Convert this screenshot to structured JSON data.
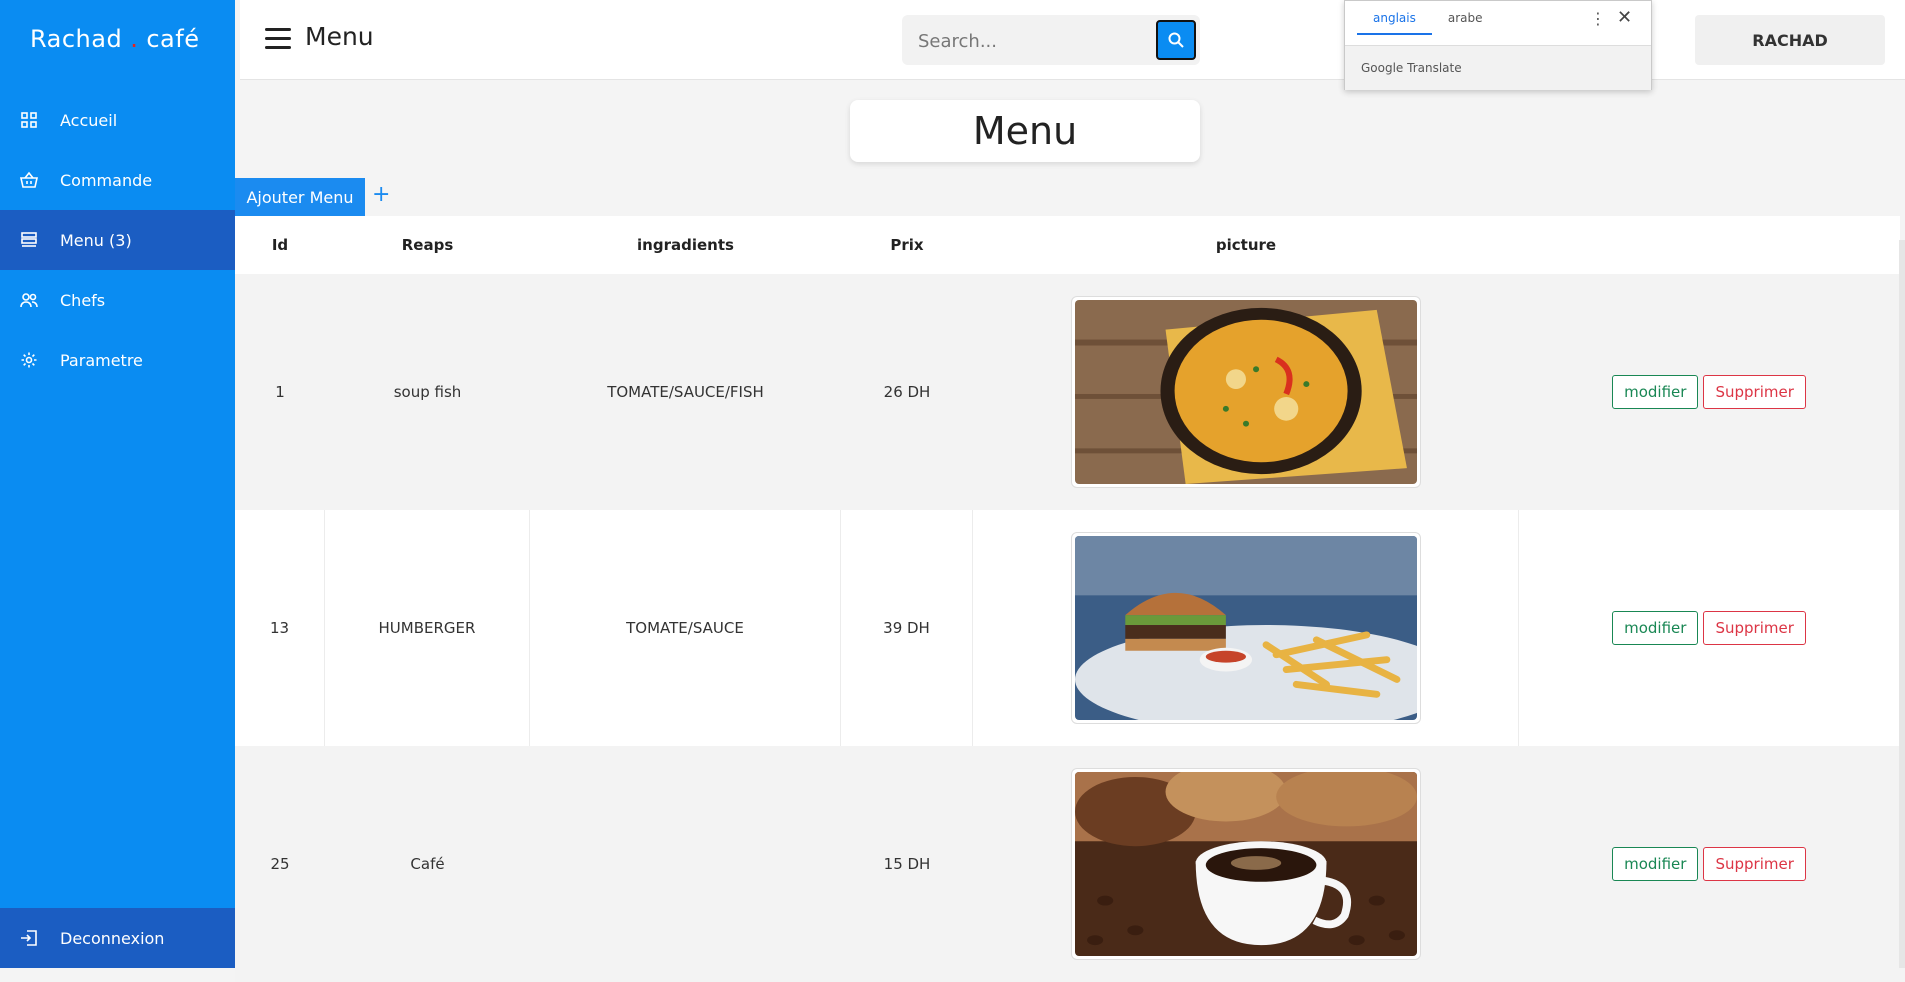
{
  "brand": {
    "name_left": "Rachad",
    "separator": ".",
    "name_right": "café"
  },
  "sidebar": {
    "items": [
      {
        "label": "Accueil",
        "icon": "grid-icon"
      },
      {
        "label": "Commande",
        "icon": "basket-icon"
      },
      {
        "label": "Menu (3)",
        "icon": "menu-list-icon",
        "active": true
      },
      {
        "label": "Chefs",
        "icon": "users-icon"
      },
      {
        "label": "Parametre",
        "icon": "gear-icon"
      }
    ],
    "logout_label": "Deconnexion"
  },
  "header": {
    "title": "Menu",
    "search_placeholder": "Search...",
    "user_label": "RACHAD"
  },
  "translate_popup": {
    "tabs": [
      "anglais",
      "arabe"
    ],
    "active_tab": "anglais",
    "footer": "Google Translate"
  },
  "main": {
    "heading": "Menu",
    "add_tab_label": "Ajouter Menu",
    "add_plus": "+",
    "table": {
      "columns": [
        "Id",
        "Reaps",
        "ingradients",
        "Prix",
        "picture"
      ],
      "rows": [
        {
          "id": "1",
          "name": "soup fish",
          "ingredients": "TOMATE/SAUCE/FISH",
          "price": "26 DH",
          "picture": "fish soup bowl"
        },
        {
          "id": "13",
          "name": "HUMBERGER",
          "ingredients": "TOMATE/SAUCE",
          "price": "39 DH",
          "picture": "hamburger with fries"
        },
        {
          "id": "25",
          "name": "Café",
          "ingredients": "",
          "price": "15 DH",
          "picture": "cup of coffee with cookies"
        }
      ],
      "edit_label": "modifier",
      "delete_label": "Supprimer"
    }
  },
  "colors": {
    "sidebar": "#0a8cf2",
    "sidebar_active": "#1b5dc2",
    "edit": "#198754",
    "delete": "#dc3545"
  }
}
